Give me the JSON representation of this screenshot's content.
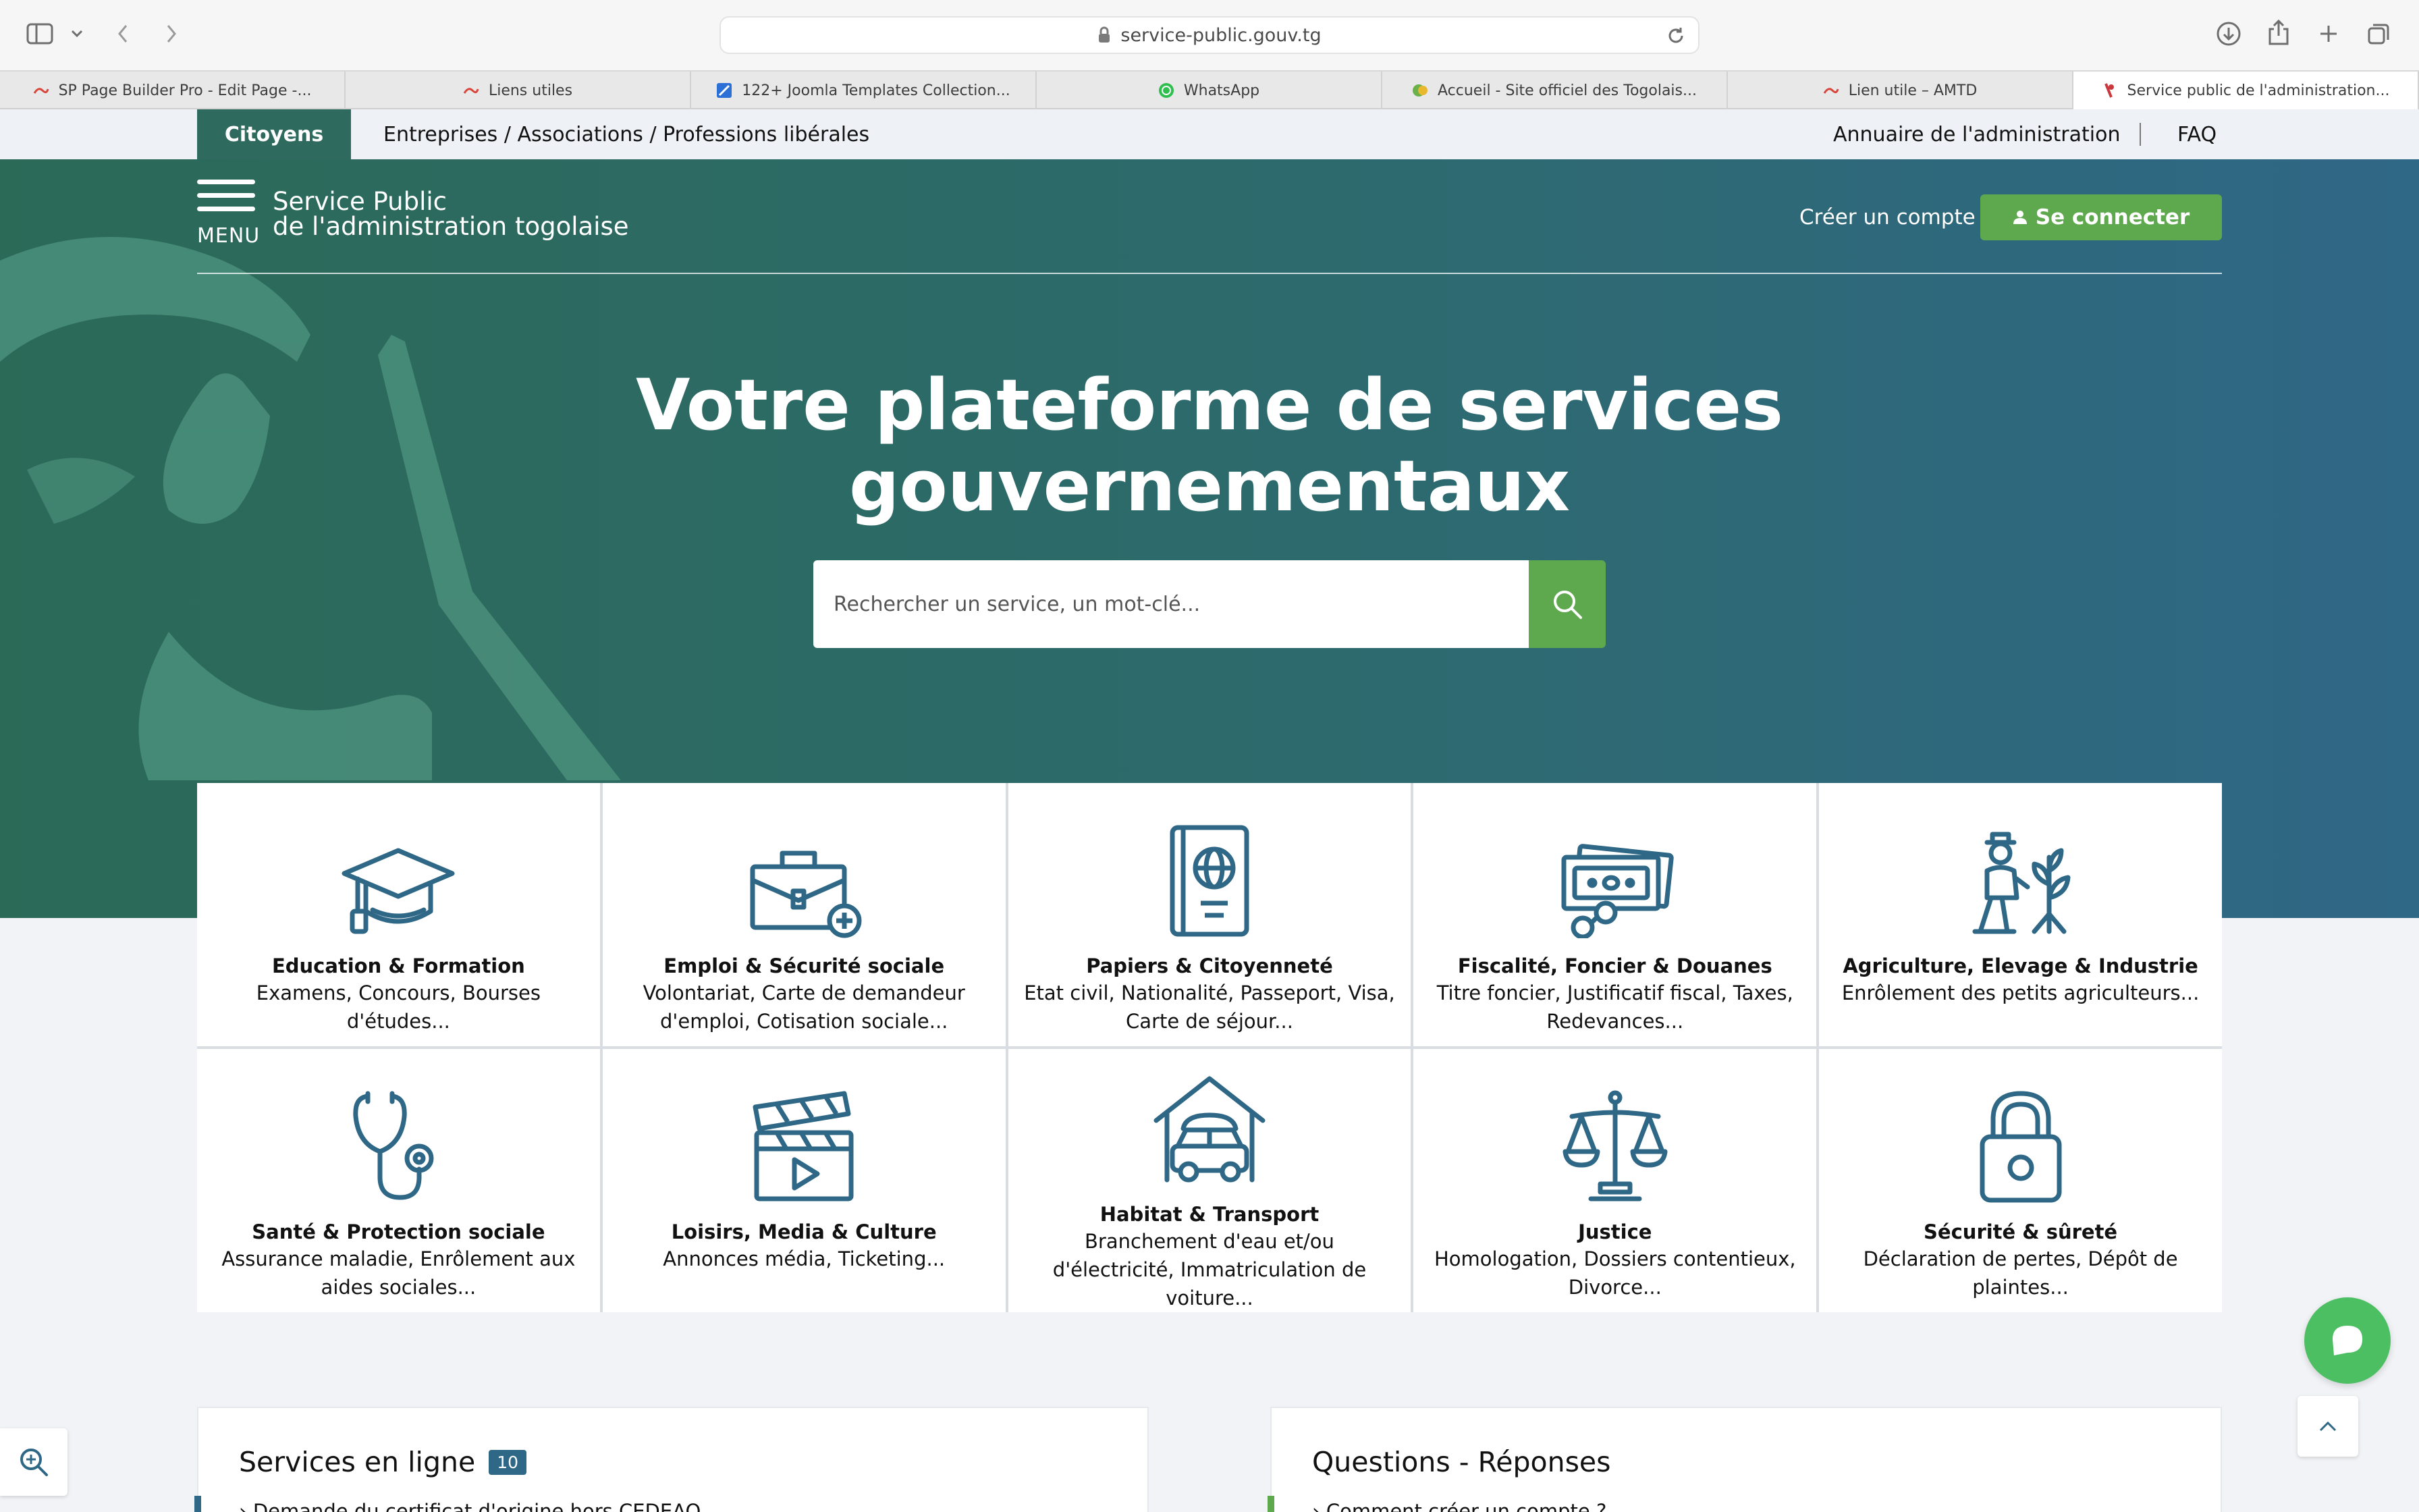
{
  "browser": {
    "url": "service-public.gouv.tg",
    "tabs": [
      {
        "label": "SP Page Builder Pro - Edit Page -...",
        "active": false
      },
      {
        "label": "Liens utiles",
        "active": false
      },
      {
        "label": "122+ Joomla Templates Collection...",
        "active": false
      },
      {
        "label": "WhatsApp",
        "active": false
      },
      {
        "label": "Accueil - Site officiel des Togolais...",
        "active": false
      },
      {
        "label": "Lien utile – AMTD",
        "active": false
      },
      {
        "label": "Service public de l'administration...",
        "active": true
      }
    ]
  },
  "topnav": {
    "citoyens": "Citoyens",
    "entreprises": "Entreprises / Associations / Professions libérales",
    "annuaire": "Annuaire de l'administration",
    "faq": "FAQ"
  },
  "header": {
    "menu_label": "MENU",
    "brand_line1": "Service Public",
    "brand_line2": "de l'administration togolaise",
    "create_account": "Créer un compte",
    "login": "Se connecter"
  },
  "hero": {
    "title_line1": "Votre plateforme de services",
    "title_line2": "gouvernementaux",
    "search_placeholder": "Rechercher un service, un mot-clé..."
  },
  "categories": [
    {
      "title": "Education & Formation",
      "desc": "Examens, Concours, Bourses d'études...",
      "icon": "graduation-cap-icon"
    },
    {
      "title": "Emploi & Sécurité sociale",
      "desc": "Volontariat, Carte de demandeur d'emploi, Cotisation sociale...",
      "icon": "briefcase-plus-icon"
    },
    {
      "title": "Papiers & Citoyenneté",
      "desc": "Etat civil, Nationalité, Passeport, Visa, Carte de séjour...",
      "icon": "passport-icon"
    },
    {
      "title": "Fiscalité, Foncier & Douanes",
      "desc": "Titre foncier, Justificatif fiscal, Taxes, Redevances...",
      "icon": "money-bills-icon"
    },
    {
      "title": "Agriculture, Elevage & Industrie",
      "desc": "Enrôlement des petits agriculteurs...",
      "icon": "farmer-plant-icon"
    },
    {
      "title": "Santé & Protection sociale",
      "desc": "Assurance maladie, Enrôlement aux aides sociales...",
      "icon": "stethoscope-icon"
    },
    {
      "title": "Loisirs, Media & Culture",
      "desc": "Annonces média, Ticketing...",
      "icon": "clapperboard-icon"
    },
    {
      "title": "Habitat & Transport",
      "desc": "Branchement d'eau et/ou d'électricité, Immatriculation de voiture...",
      "icon": "house-car-icon"
    },
    {
      "title": "Justice",
      "desc": "Homologation, Dossiers contentieux, Divorce...",
      "icon": "scales-icon"
    },
    {
      "title": "Sécurité & sûreté",
      "desc": "Déclaration de pertes, Dépôt de plaintes...",
      "icon": "padlock-icon"
    }
  ],
  "panels": {
    "services_title": "Services en ligne",
    "services_count": "10",
    "services_first_item": "Demande du certificat d'origine hors CEDEAO",
    "qa_title": "Questions - Réponses",
    "qa_first_item": "Comment créer un compte ?"
  },
  "colors": {
    "brand_green": "#2e6b5e",
    "button_green": "#5ea94e",
    "icon_blue": "#2f6786",
    "chat_green": "#4cbf63"
  }
}
